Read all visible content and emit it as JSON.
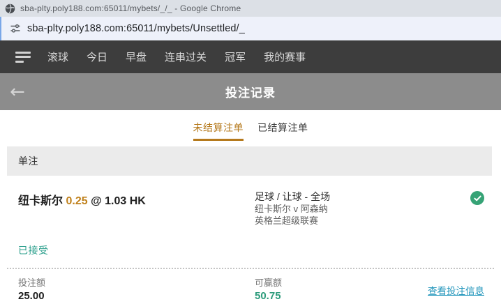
{
  "window": {
    "title": "sba-plty.poly188.com:65011/mybets/_/_ - Google Chrome"
  },
  "address_bar": {
    "url": "sba-plty.poly188.com:65011/mybets/Unsettled/_"
  },
  "navbar": {
    "items": [
      {
        "label": "滚球"
      },
      {
        "label": "今日"
      },
      {
        "label": "早盘"
      },
      {
        "label": "连串过关"
      },
      {
        "label": "冠军"
      },
      {
        "label": "我的赛事"
      }
    ]
  },
  "header": {
    "back_icon": "arrow-left-icon",
    "back_glyph": "←",
    "title": "投注记录"
  },
  "tabs": {
    "unsettled": {
      "label": "未结算注单",
      "active": true
    },
    "settled": {
      "label": "已结算注单",
      "active": false
    }
  },
  "section": {
    "title": "单注"
  },
  "bet": {
    "selection": "纽卡斯尔",
    "handicap": "0.25",
    "at_symbol": "@",
    "odds": "1.03",
    "odds_format": "HK",
    "market": "足球 / 让球 - 全场",
    "match": "纽卡斯尔 v 阿森纳",
    "league": "英格兰超级联赛",
    "status": "已接受",
    "status_icon": "check-circle-icon",
    "stake_label": "投注额",
    "stake_value": "25.00",
    "win_label": "可赢额",
    "win_value": "50.75",
    "details_link": "查看投注信息"
  },
  "colors": {
    "navbar_bg": "#3d3d3d",
    "header_bg": "#8c8c8c",
    "accent_orange": "#b5791c",
    "status_teal": "#2da08d",
    "win_green": "#2e9c7c",
    "link_blue": "#2095bb",
    "check_green": "#36a376",
    "section_bg": "#ebebeb"
  }
}
